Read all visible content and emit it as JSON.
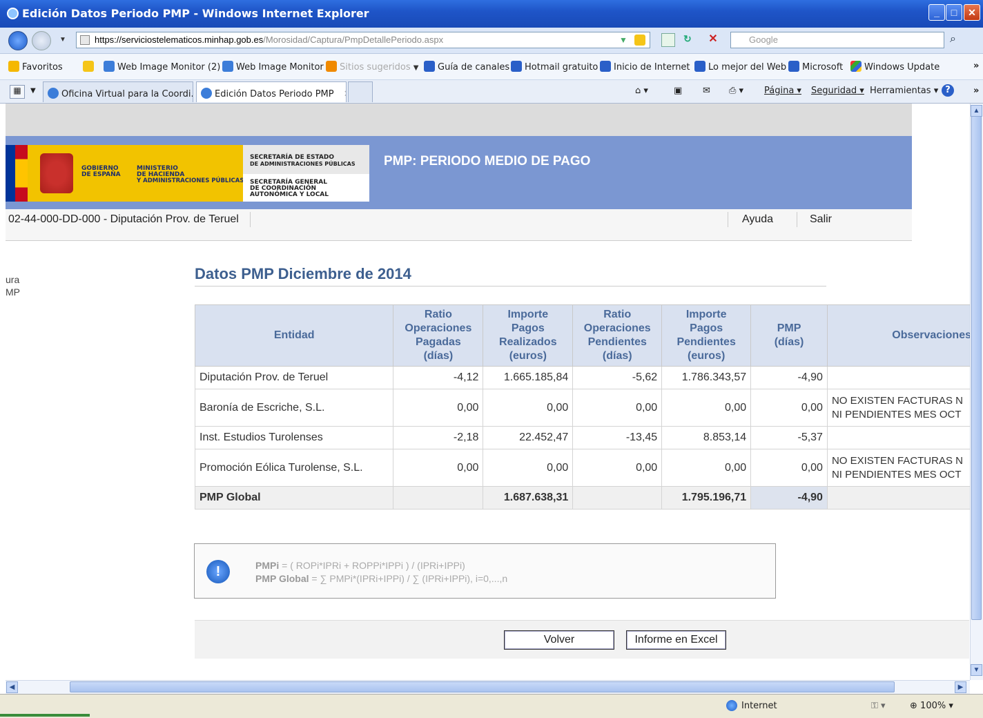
{
  "window": {
    "title": "Edición Datos Periodo PMP - Windows Internet Explorer"
  },
  "address": {
    "url_prefix": "https://serviciostelematicos.",
    "url_domain": "minhap.gob.es",
    "url_path": "/Morosidad/Captura/PmpDetallePeriodo.aspx",
    "search_placeholder": "Google"
  },
  "favorites": {
    "label": "Favoritos",
    "items": [
      "Web Image Monitor (2)",
      "Web Image Monitor",
      "Sitios sugeridos",
      "Guía de canales",
      "Hotmail gratuito",
      "Inicio de Internet",
      "Lo mejor del Web",
      "Microsoft",
      "Windows Update"
    ]
  },
  "tabs": [
    {
      "label": "Oficina Virtual para la Coordi..."
    },
    {
      "label": "Edición Datos Periodo PMP"
    }
  ],
  "commands": {
    "page": "Página",
    "security": "Seguridad",
    "tools": "Herramientas"
  },
  "banner": {
    "gov_line1": "GOBIERNO",
    "gov_line2": "DE ESPAÑA",
    "min_line1": "MINISTERIO",
    "min_line2": "DE HACIENDA",
    "min_line3": "Y ADMINISTRACIONES PÚBLICAS",
    "sec1_line1": "SECRETARÍA DE ESTADO",
    "sec1_line2": "DE ADMINISTRACIONES PÚBLICAS",
    "sec2_line1": "SECRETARÍA GENERAL",
    "sec2_line2": "DE COORDINACIÓN",
    "sec2_line3": "AUTONÓMICA Y LOCAL",
    "title": "PMP: PERIODO MEDIO DE PAGO"
  },
  "userbar": {
    "entity": "02-44-000-DD-000 - Diputación Prov. de Teruel",
    "help": "Ayuda",
    "logout": "Salir"
  },
  "left_menu": {
    "line1": "ura",
    "line2": "MP"
  },
  "main": {
    "heading": "Datos PMP Diciembre de 2014",
    "columns": {
      "entity": "Entidad",
      "ratio_paid": [
        "Ratio",
        "Operaciones",
        "Pagadas",
        "(días)"
      ],
      "amount_paid": [
        "Importe",
        "Pagos",
        "Realizados",
        "(euros)"
      ],
      "ratio_pending": [
        "Ratio",
        "Operaciones",
        "Pendientes",
        "(días)"
      ],
      "amount_pending": [
        "Importe",
        "Pagos",
        "Pendientes",
        "(euros)"
      ],
      "pmp": [
        "PMP",
        "(días)"
      ],
      "observations": "Observaciones"
    },
    "rows": [
      {
        "entity": "Diputación Prov. de Teruel",
        "ratio_paid": "-4,12",
        "amount_paid": "1.665.185,84",
        "ratio_pending": "-5,62",
        "amount_pending": "1.786.343,57",
        "pmp": "-4,90",
        "obs1": "",
        "obs2": ""
      },
      {
        "entity": "Baronía de Escriche, S.L.",
        "ratio_paid": "0,00",
        "amount_paid": "0,00",
        "ratio_pending": "0,00",
        "amount_pending": "0,00",
        "pmp": "0,00",
        "obs1": "NO EXISTEN FACTURAS N",
        "obs2": "NI PENDIENTES MES OCT"
      },
      {
        "entity": "Inst. Estudios Turolenses",
        "ratio_paid": "-2,18",
        "amount_paid": "22.452,47",
        "ratio_pending": "-13,45",
        "amount_pending": "8.853,14",
        "pmp": "-5,37",
        "obs1": "",
        "obs2": ""
      },
      {
        "entity": "Promoción Eólica Turolense, S.L.",
        "ratio_paid": "0,00",
        "amount_paid": "0,00",
        "ratio_pending": "0,00",
        "amount_pending": "0,00",
        "pmp": "0,00",
        "obs1": "NO EXISTEN FACTURAS N",
        "obs2": "NI PENDIENTES MES OCT"
      }
    ],
    "total": {
      "label": "PMP Global",
      "amount_paid": "1.687.638,31",
      "amount_pending": "1.795.196,71",
      "pmp": "-4,90"
    },
    "formula": {
      "pmpi_label": "PMPi",
      "pmpi_expr": " = ( ROPi*IPRi + ROPPi*IPPi ) / (IPRi+IPPi)",
      "global_label": "PMP Global",
      "global_expr": " = ∑ PMPi*(IPRi+IPPi) / ∑ (IPRi+IPPi), i=0,...,n"
    },
    "buttons": {
      "back": "Volver",
      "excel": "Informe en Excel"
    }
  },
  "status": {
    "zone": "Internet",
    "zoom": "100%"
  }
}
